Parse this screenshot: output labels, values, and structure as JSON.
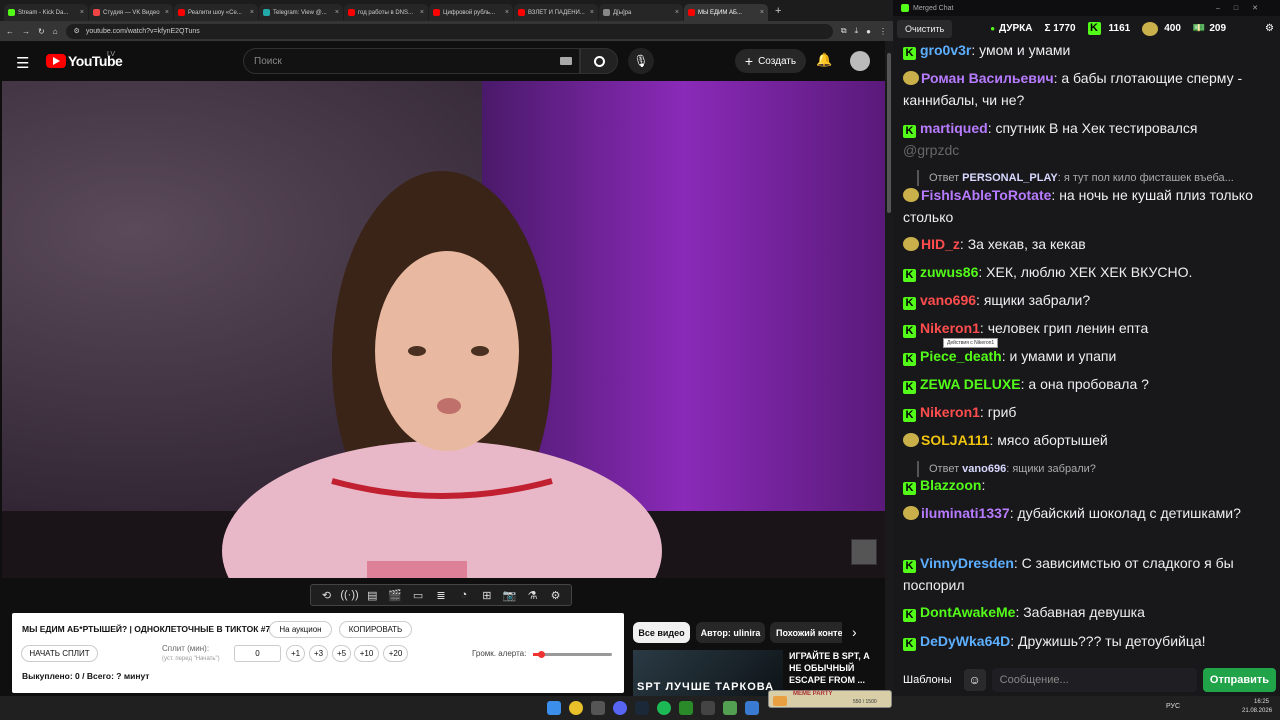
{
  "browser": {
    "tabs": [
      {
        "label": "Stream - Kick Da...",
        "color": "#53fc18"
      },
      {
        "label": "Студия — VK Видео",
        "color": "#e44"
      },
      {
        "label": "Реалити шоу «Се...",
        "color": "#f00"
      },
      {
        "label": "Telegram: View @...",
        "color": "#2aa"
      },
      {
        "label": "год работы в DNS...",
        "color": "#f00"
      },
      {
        "label": "Цифровой рубль...",
        "color": "#f00"
      },
      {
        "label": "ВЗЛЕТ И ПАДЕНИ...",
        "color": "#f00"
      },
      {
        "label": "Д[ы]ра",
        "color": "#888"
      },
      {
        "label": "МЫ ЕДИМ АБ...",
        "color": "#f00",
        "active": true
      }
    ],
    "url": "youtube.com/watch?v=kfynE2QTuns"
  },
  "youtube": {
    "logo_text": "YouTube",
    "region": "LV",
    "search_placeholder": "Поиск",
    "create_label": "Создать"
  },
  "controls": {
    "icons": [
      "repeat-icon",
      "audio-icon",
      "menu-icon",
      "clapper-icon",
      "frame-icon",
      "list-icon",
      "speed-icon",
      "add-icon",
      "camera-icon",
      "flask-icon",
      "gear-icon"
    ]
  },
  "kick_panel": {
    "title": "МЫ ЕДИМ АБ*РТЫШЕЙ? | ОДНОКЛЕТОЧНЫЕ В ТИКТОК #7",
    "auction_button": "На аукцион",
    "copy_button": "КОПИРОВАТЬ",
    "start_split_button": "НАЧАТЬ СПЛИТ",
    "split_label": "Сплит (мин):",
    "split_hint": "(уст. перед \"Начать\")",
    "split_value": "0",
    "increments": [
      "+1",
      "+3",
      "+5",
      "+10",
      "+20"
    ],
    "alert_volume_label": "Громк. алерта:",
    "alert_volume": 0.1,
    "summary": "Выкуплено: 0 / Всего: ? минут"
  },
  "related": {
    "chips": [
      "Все видео",
      "Автор: ulinira",
      "Похожий конте"
    ],
    "video_title": "ИГРАЙТЕ В SPT, А НЕ ОБЫЧНЫЙ ESCAPE FROM ...",
    "thumb_text": "SPT ЛУЧШЕ ТАРКОВА"
  },
  "chat": {
    "window_title": "Merged Chat",
    "clear_button": "Очистить",
    "channel": "ДУРКА",
    "stats": [
      {
        "icon": "sigma-icon",
        "value": "Σ 1770"
      },
      {
        "icon": "kick-icon",
        "value": "1161"
      },
      {
        "icon": "emote-icon",
        "value": "400"
      },
      {
        "icon": "money-icon",
        "value": "209"
      }
    ],
    "messages": [
      {
        "user": "gro0v3r",
        "color": "#5dafff",
        "platform": "kick",
        "text": "умом и умами"
      },
      {
        "user": "Роман Васильевич",
        "color": "#b77bff",
        "platform": "twitch",
        "text": "а бабы глотающие сперму - каннибалы, чи не?"
      },
      {
        "user": "martiqued",
        "color": "#b77bff",
        "platform": "kick",
        "text": "спутник В на Хек тестировался"
      },
      {
        "mention": "@grpzdc"
      },
      {
        "reply_user": "PERSONAL_PLAY",
        "reply_text": "я тут пол кило фисташек въеба..."
      },
      {
        "user": "FishIsAbleToRotate",
        "color": "#b77bff",
        "platform": "twitch",
        "text": "на ночь не кушай плиз только столько"
      },
      {
        "user": "HID_z",
        "color": "#ff4d4d",
        "platform": "twitch",
        "text": "За хекав, за кекав"
      },
      {
        "user": "zuwus86",
        "color": "#53fc18",
        "platform": "kick",
        "text": "ХЕК, люблю ХЕК   ХЕК ВКУСНО."
      },
      {
        "user": "vano696",
        "color": "#ff4d4d",
        "platform": "kick",
        "text": "ящики забрали?"
      },
      {
        "user": "Nikeron1",
        "color": "#ff4d4d",
        "platform": "kick",
        "text": "человек грип ленин епта"
      },
      {
        "user": "Piece_death",
        "color": "#53fc18",
        "platform": "kick",
        "text": "и умами и упапи"
      },
      {
        "user": "ZEWA DELUXE",
        "color": "#53fc18",
        "platform": "kick",
        "text": "а она пробовала ?"
      },
      {
        "user": "Nikeron1",
        "color": "#ff4d4d",
        "platform": "kick",
        "text": "гриб"
      },
      {
        "user": "SOLJA111",
        "color": "#f1c40f",
        "platform": "twitch",
        "text": "мясо абортышей"
      },
      {
        "reply_user": "vano696",
        "reply_text": "ящики забрали?"
      },
      {
        "user": "Blazzoon",
        "color": "#53fc18",
        "platform": "kick",
        "text": ""
      },
      {
        "user": "iluminati1337",
        "color": "#b77bff",
        "platform": "twitch",
        "text": "дубайский шоколад с детишками?"
      },
      {
        "user": "VinnyDresden",
        "color": "#5dafff",
        "platform": "kick",
        "text": "С зависимстью от сладкого я бы поспорил"
      },
      {
        "user": "DontAwakeMe",
        "color": "#53fc18",
        "platform": "kick",
        "text": "Забавная девушка"
      },
      {
        "user": "DeDyWka64D",
        "color": "#5dafff",
        "platform": "kick",
        "text": "Дружишь??? ты детоубийца!"
      }
    ],
    "tooltip": "Действия с Nikeron1",
    "templates_button": "Шаблоны",
    "input_placeholder": "Сообщение...",
    "send_button": "Отправить"
  },
  "taskbar": {
    "lang": "РУС",
    "time": "16:25",
    "date": "21.08.2026",
    "overlay_text": "MEME PARTY",
    "overlay_count": "550 / 1500"
  }
}
